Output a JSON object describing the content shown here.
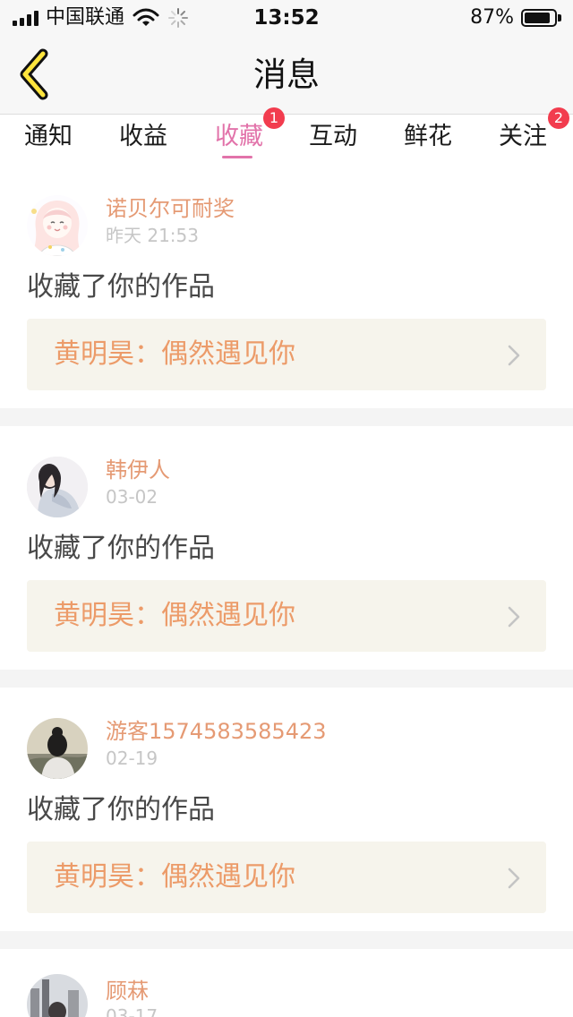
{
  "status_bar": {
    "carrier": "中国联通",
    "time": "13:52",
    "battery_text": "87%",
    "battery_level": 87,
    "icons": [
      "signal-icon",
      "wifi-icon",
      "loading-spinner-icon",
      "battery-icon"
    ]
  },
  "header": {
    "title": "消息",
    "back_icon": "chevron-left-icon"
  },
  "tabs": [
    {
      "label": "通知",
      "active": false,
      "badge": ""
    },
    {
      "label": "收益",
      "active": false,
      "badge": ""
    },
    {
      "label": "收藏",
      "active": true,
      "badge": "1"
    },
    {
      "label": "互动",
      "active": false,
      "badge": ""
    },
    {
      "label": "鲜花",
      "active": false,
      "badge": ""
    },
    {
      "label": "关注",
      "active": false,
      "badge": "2"
    }
  ],
  "messages": [
    {
      "user": "诺贝尔可耐奖",
      "time": "昨天 21:53",
      "action": "收藏了你的作品",
      "work": "黄明昊：偶然遇见你",
      "avatar_icon": "anime-girl-avatar"
    },
    {
      "user": "韩伊人",
      "time": "03-02",
      "action": "收藏了你的作品",
      "work": "黄明昊：偶然遇见你",
      "avatar_icon": "girl-photo-avatar"
    },
    {
      "user": "游客1574583585423",
      "time": "02-19",
      "action": "收藏了你的作品",
      "work": "黄明昊：偶然遇见你",
      "avatar_icon": "person-back-avatar"
    },
    {
      "user": "顾菻",
      "time": "03-17",
      "action": "",
      "work": "",
      "avatar_icon": "city-photo-avatar"
    }
  ],
  "colors": {
    "accent_pink": "#e273aa",
    "badge_red": "#f23c4e",
    "user_orange": "#e59a74",
    "work_orange": "#ec9b69",
    "back_yellow": "#ffe53d"
  }
}
